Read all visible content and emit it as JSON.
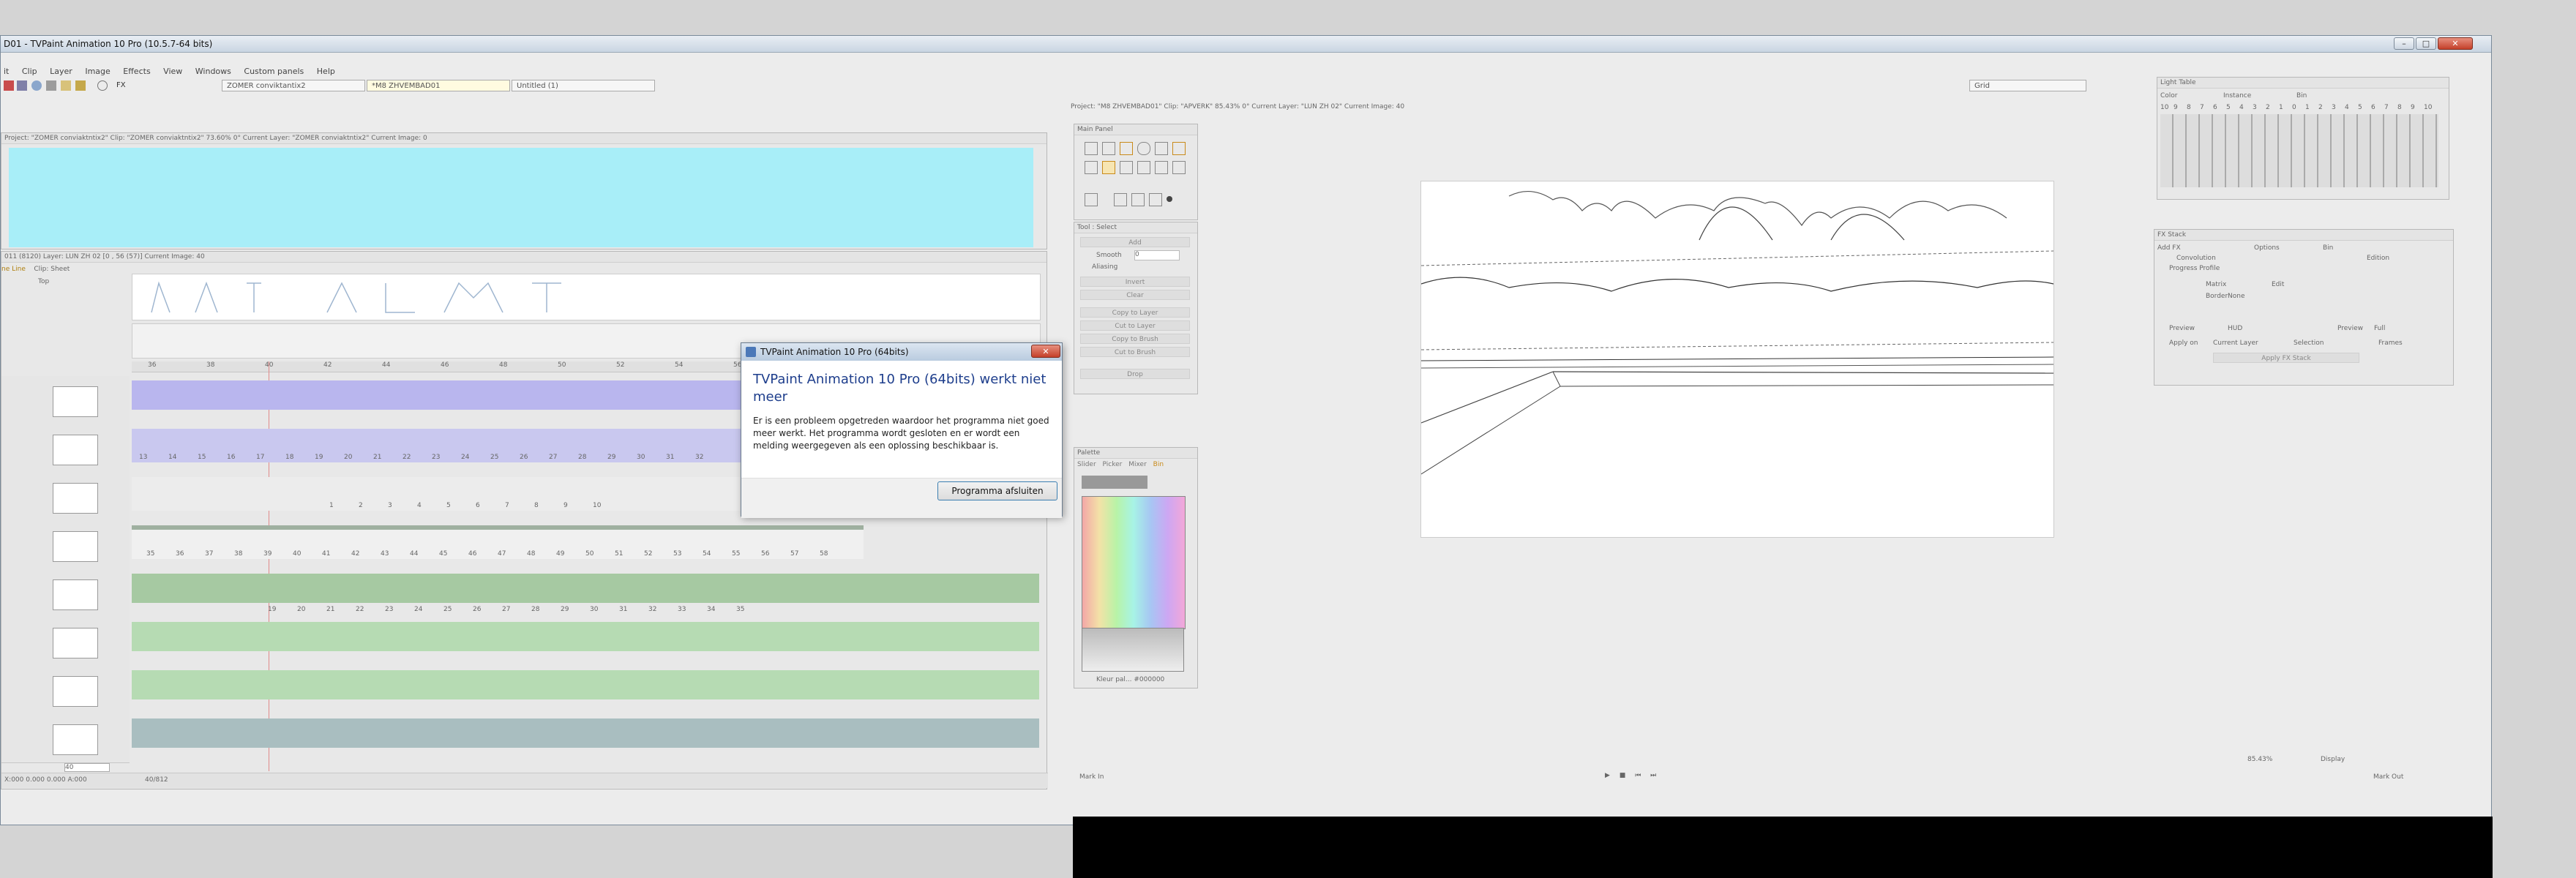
{
  "window": {
    "title": "D01 - TVPaint Animation 10 Pro (10.5.7-64 bits)"
  },
  "menu": [
    "it",
    "Clip",
    "Layer",
    "Image",
    "Effects",
    "View",
    "Windows",
    "Custom panels",
    "Help"
  ],
  "toolbar": {
    "fx_label": "FX",
    "tabs": [
      "ZOMER conviktantix2",
      "*M8 ZHVEMBAD01",
      "Untitled (1)"
    ],
    "grid_label": "Grid"
  },
  "project_panel": {
    "header": "Project: \"ZOMER conviaktntix2\"  Clip: \"ZOMER conviaktntix2\"  73.60%  0°  Current Layer: \"ZOMER conviaktntix2\"  Current Image: 0"
  },
  "timeline": {
    "header": "011 (8120)     Layer: LUN ZH 02 [0 , 56 (57)]   Current Image: 40",
    "tabs": [
      "ne Line",
      "Clip: Sheet"
    ],
    "mode_label": "Top",
    "ruler": [
      "36",
      "38",
      "40",
      "42",
      "44",
      "46",
      "48",
      "50",
      "52",
      "54",
      "56"
    ],
    "track2_numbers": [
      "13",
      "14",
      "15",
      "16",
      "17",
      "18",
      "19",
      "20",
      "21",
      "22",
      "23",
      "24",
      "25",
      "26",
      "27",
      "28",
      "29",
      "30",
      "31",
      "32"
    ],
    "track3_numbers": [
      "1",
      "2",
      "3",
      "4",
      "5",
      "6",
      "7",
      "8",
      "9",
      "10"
    ],
    "track4_numbers": [
      "35",
      "36",
      "37",
      "38",
      "39",
      "40",
      "41",
      "42",
      "43",
      "44",
      "45",
      "46",
      "47",
      "48",
      "49",
      "50",
      "51",
      "52",
      "53",
      "54",
      "55",
      "56",
      "57",
      "58"
    ],
    "track5_numbers": [
      "19",
      "20",
      "21",
      "22",
      "23",
      "24",
      "25",
      "26",
      "27",
      "28",
      "29",
      "30",
      "31",
      "32",
      "33",
      "34",
      "35"
    ],
    "current_frame": "40",
    "status_left": "X:000 0.000 0.000 A:000",
    "status_mid": "40/812",
    "frame_field": "40"
  },
  "viewport": {
    "header": "Project: \"M8 ZHVEMBAD01\"  Clip: \"APVERK\"  85.43%  0°  Current Layer: \"LUN ZH 02\"  Current Image: 40",
    "mark_in": "Mark In",
    "mark_out": "Mark Out",
    "zoom": "85.43%",
    "display": "Display"
  },
  "main_panel": {
    "title": "Main Panel"
  },
  "tool_panel": {
    "title": "Tool : Select",
    "mode": "Add",
    "smooth_label": "Smooth",
    "smooth_value": "0",
    "aliasing_label": "Aliasing",
    "buttons": [
      "Invert",
      "Clear",
      "Copy to Layer",
      "Cut to Layer",
      "Copy to Brush",
      "Cut to Brush",
      "Drop"
    ]
  },
  "palette": {
    "title": "Palette",
    "tabs": [
      "Slider",
      "Picker",
      "Mixer",
      "Bin"
    ],
    "footer": "Kleur pal... #000000"
  },
  "light_table": {
    "title": "Light Table",
    "color_label": "Color",
    "instance_label": "Instance",
    "bin_label": "Bin",
    "scale": [
      "10",
      "9",
      "8",
      "7",
      "6",
      "5",
      "4",
      "3",
      "2",
      "1",
      "0",
      "1",
      "2",
      "3",
      "4",
      "5",
      "6",
      "7",
      "8",
      "9",
      "10"
    ]
  },
  "fx_stack": {
    "title": "FX Stack",
    "add_fx": "Add FX",
    "options": "Options",
    "bin": "Bin",
    "progress_profile": "Progress Profile",
    "effect": "Convolution",
    "effect_mode": "Edition",
    "matrix_label": "Matrix",
    "matrix_value": "Edit",
    "border_label": "Border",
    "border_value": "None",
    "preview_label": "Preview",
    "preview_value": "HUD",
    "preview2_label": "Preview",
    "preview2_value": "Full",
    "apply_on_label": "Apply on",
    "apply_on_value": "Current Layer",
    "selection": "Selection",
    "frames": "Frames",
    "apply_button": "Apply FX Stack"
  },
  "dialog": {
    "title": "TVPaint Animation 10 Pro (64bits)",
    "heading": "TVPaint Animation 10 Pro (64bits) werkt niet meer",
    "body": "Er is een probleem opgetreden waardoor het programma niet goed meer werkt. Het programma wordt gesloten en er wordt een melding weergegeven als een oplossing beschikbaar is.",
    "button": "Programma afsluiten"
  },
  "colors": {
    "dialog_heading": "#1e3e8c",
    "cyan_canvas": "#a8eef8",
    "track_blue": "#b9b6ee",
    "track_green": "#b6dbb3",
    "track_gray": "#a9bec0",
    "close_red": "#c4402a"
  }
}
